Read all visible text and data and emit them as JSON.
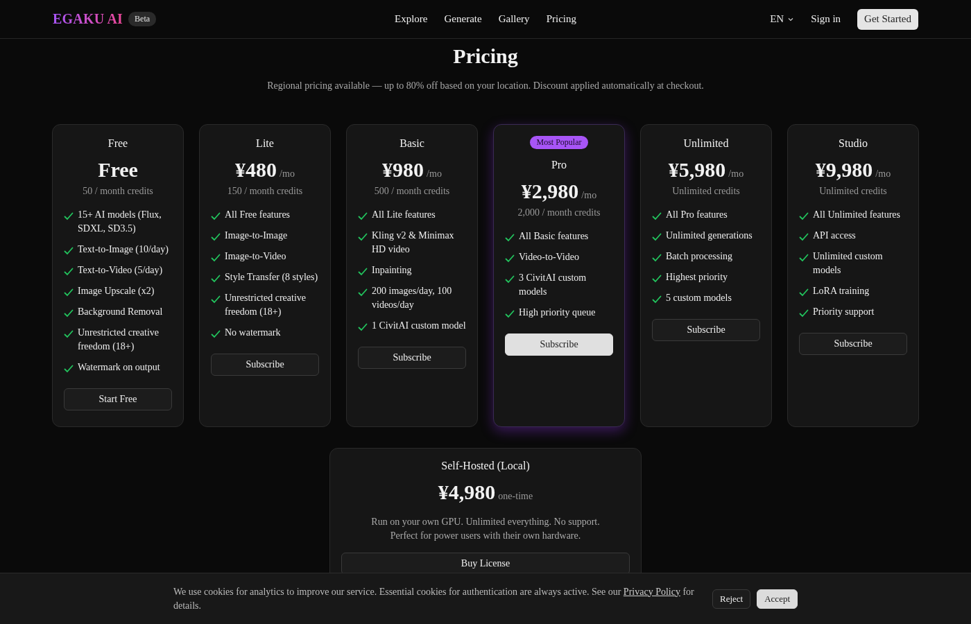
{
  "header": {
    "brand": "EGAKU AI",
    "badge": "Beta",
    "links": [
      {
        "label": "Explore"
      },
      {
        "label": "Generate"
      },
      {
        "label": "Gallery"
      },
      {
        "label": "Pricing"
      }
    ],
    "language": "EN",
    "sign_in": "Sign in",
    "cta": "Get Started"
  },
  "title": "Pricing",
  "subtitle": "Regional pricing available — up to 80% off based on your location. Discount applied automatically at checkout.",
  "plans": [
    {
      "name": "Free",
      "price": "Free",
      "credits": "50 / month credits",
      "highlighted": false,
      "features": [
        "15+ AI models (Flux, SDXL, SD3.5)",
        "Text-to-Image (10/day)",
        "Text-to-Video (5/day)",
        "Image Upscale (x2)",
        "Background Removal",
        "Unrestricted creative freedom (18+)",
        "Watermark on output"
      ],
      "button": {
        "label": "Start Free",
        "primary": false
      }
    },
    {
      "name": "Lite",
      "price": "¥480",
      "period": "/mo",
      "credits": "150 / month credits",
      "highlighted": false,
      "features": [
        "All Free features",
        "Image-to-Image",
        "Image-to-Video",
        "Style Transfer (8 styles)",
        "Unrestricted creative freedom (18+)",
        "No watermark"
      ],
      "button": {
        "label": "Subscribe",
        "primary": false
      }
    },
    {
      "name": "Basic",
      "price": "¥980",
      "period": "/mo",
      "credits": "500 / month credits",
      "highlighted": false,
      "features": [
        "All Lite features",
        "Kling v2 & Minimax HD video",
        "Inpainting",
        "200 images/day, 100 videos/day",
        "1 CivitAI custom model"
      ],
      "button": {
        "label": "Subscribe",
        "primary": false
      }
    },
    {
      "name": "Pro",
      "badge": "Most Popular",
      "price": "¥2,980",
      "period": "/mo",
      "credits": "2,000 / month credits",
      "highlighted": true,
      "features": [
        "All Basic features",
        "Video-to-Video",
        "3 CivitAI custom models",
        "High priority queue"
      ],
      "button": {
        "label": "Subscribe",
        "primary": true
      }
    },
    {
      "name": "Unlimited",
      "price": "¥5,980",
      "period": "/mo",
      "credits": "Unlimited credits",
      "highlighted": false,
      "features": [
        "All Pro features",
        "Unlimited generations",
        "Batch processing",
        "Highest priority",
        "5 custom models"
      ],
      "button": {
        "label": "Subscribe",
        "primary": false
      }
    },
    {
      "name": "Studio",
      "price": "¥9,980",
      "period": "/mo",
      "credits": "Unlimited credits",
      "highlighted": false,
      "features": [
        "All Unlimited features",
        "API access",
        "Unlimited custom models",
        "LoRA training",
        "Priority support"
      ],
      "button": {
        "label": "Subscribe",
        "primary": false
      }
    }
  ],
  "self_hosted": {
    "name": "Self-Hosted (Local)",
    "price": "¥4,980",
    "period": "one-time",
    "description": "Run on your own GPU. Unlimited everything. No support. Perfect for power users with their own hardware.",
    "button": "Buy License"
  },
  "cookie_banner": {
    "text_before": "We use cookies for analytics to improve our service. Essential cookies for authentication are always active. See our",
    "link": "Privacy Policy",
    "text_after": "for details.",
    "buttons": [
      {
        "label": "Reject",
        "primary": false
      },
      {
        "label": "Accept",
        "primary": true
      }
    ]
  }
}
